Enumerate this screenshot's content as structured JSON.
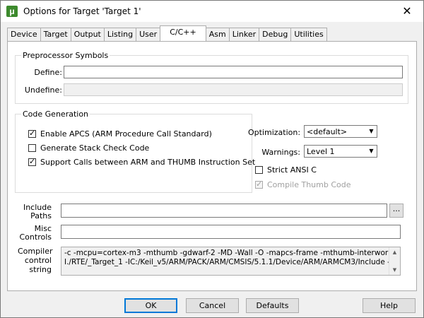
{
  "window": {
    "title": "Options for Target 'Target 1'",
    "close_glyph": "✕",
    "icon_text": "μ"
  },
  "tabs": [
    {
      "label": "Device"
    },
    {
      "label": "Target"
    },
    {
      "label": "Output"
    },
    {
      "label": "Listing"
    },
    {
      "label": "User"
    },
    {
      "label": "C/C++"
    },
    {
      "label": "Asm"
    },
    {
      "label": "Linker"
    },
    {
      "label": "Debug"
    },
    {
      "label": "Utilities"
    }
  ],
  "active_tab": "C/C++",
  "preprocessor": {
    "legend": "Preprocessor Symbols",
    "define_label": "Define:",
    "define_value": "",
    "undefine_label": "Undefine:",
    "undefine_value": ""
  },
  "codegen": {
    "legend": "Code Generation",
    "apcs": {
      "label": "Enable APCS (ARM Procedure Call Standard)",
      "checked": true
    },
    "stack_check": {
      "label": "Generate Stack Check Code",
      "checked": false
    },
    "interwork": {
      "label": "Support Calls between ARM and THUMB Instruction Set",
      "checked": true
    }
  },
  "optimization": {
    "label": "Optimization:",
    "value": "<default>"
  },
  "warnings": {
    "label": "Warnings:",
    "value": "Level 1"
  },
  "strict_ansi": {
    "label": "Strict ANSI C",
    "checked": false
  },
  "compile_thumb": {
    "label": "Compile Thumb Code",
    "checked": true,
    "disabled": true
  },
  "include_paths": {
    "label_line1": "Include",
    "label_line2": "Paths",
    "value": "",
    "browse_label": "..."
  },
  "misc_controls": {
    "label_line1": "Misc",
    "label_line2": "Controls",
    "value": ""
  },
  "compiler_control": {
    "label_line1": "Compiler",
    "label_line2": "control",
    "label_line3": "string",
    "line1": "-c -mcpu=cortex-m3 -mthumb -gdwarf-2 -MD -Wall -O -mapcs-frame -mthumb-interwork -",
    "line2": "I./RTE/_Target_1 -IC:/Keil_v5/ARM/PACK/ARM/CMSIS/5.1.1/Device/ARM/ARMCM3/Include -"
  },
  "buttons": {
    "ok": "OK",
    "cancel": "Cancel",
    "defaults": "Defaults",
    "help": "Help"
  }
}
